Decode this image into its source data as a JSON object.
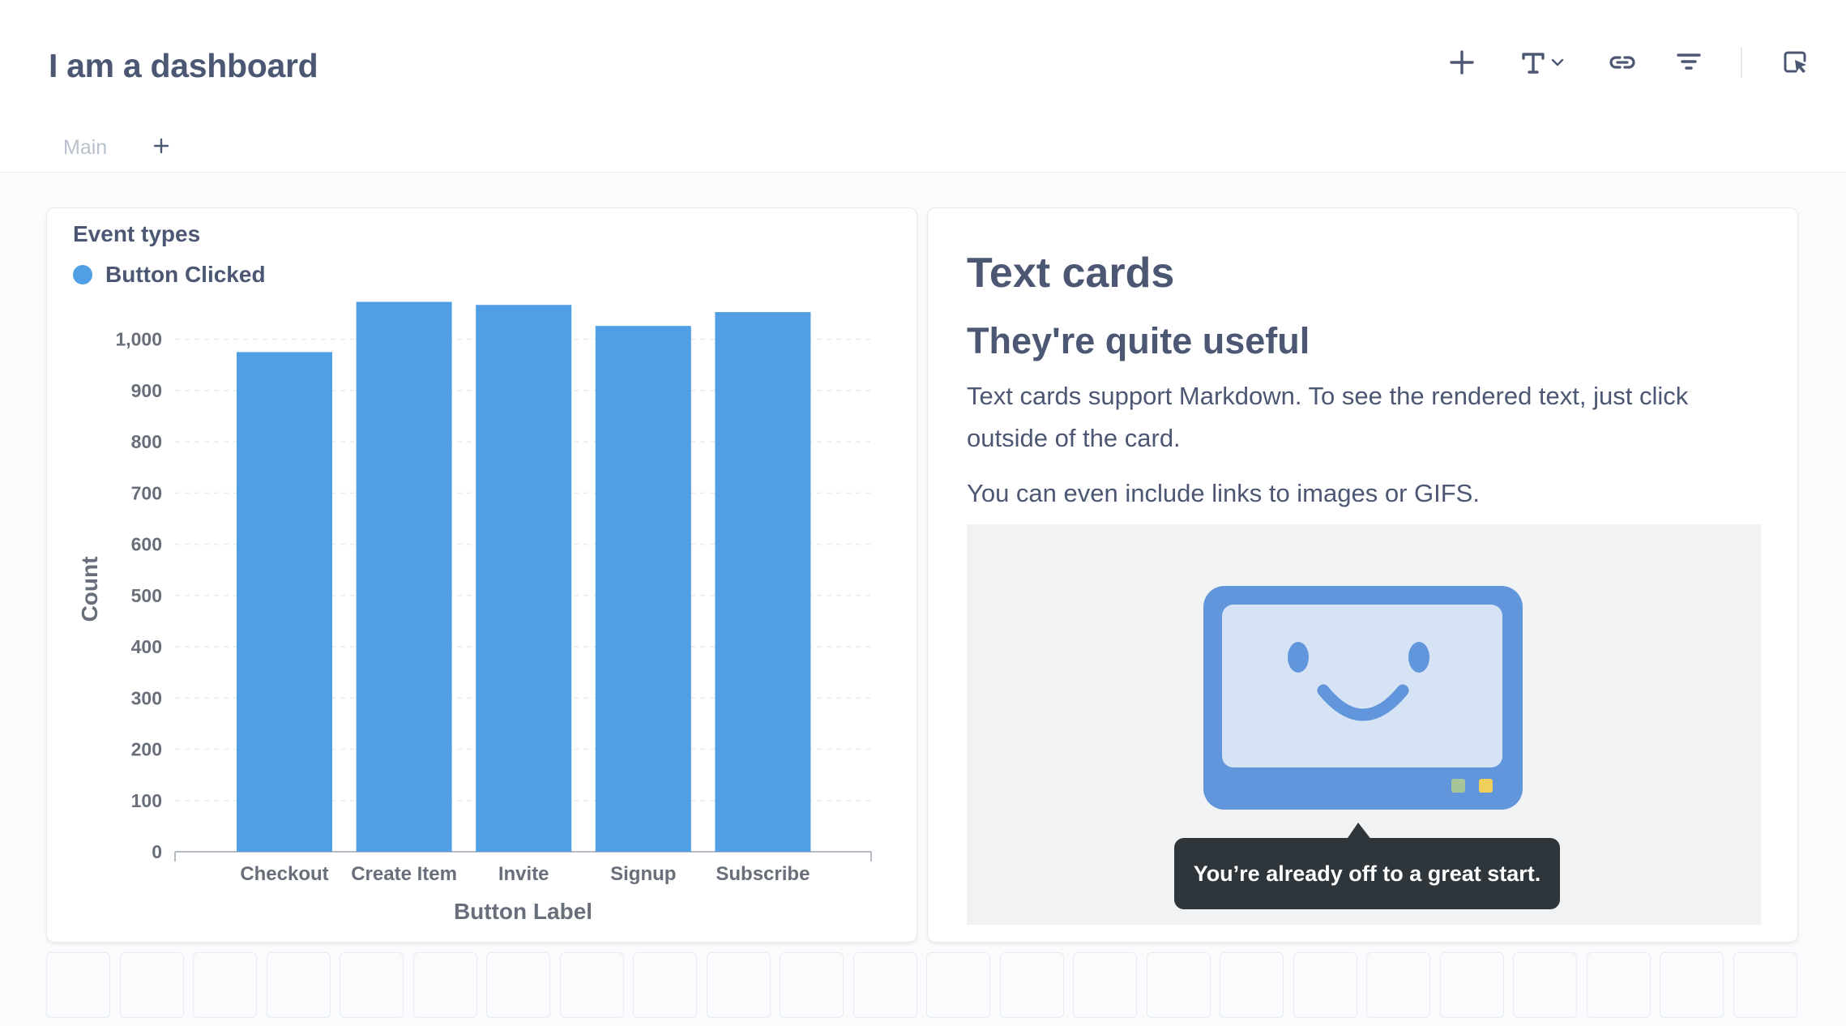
{
  "header": {
    "title": "I am a dashboard",
    "tabs": [
      {
        "label": "Main"
      }
    ],
    "add_tab_label": "+"
  },
  "toolbar": {
    "icons": [
      "add-icon",
      "text-card-icon",
      "chevron-down-icon",
      "link-icon",
      "filter-icon",
      "click-behavior-icon"
    ]
  },
  "chart_card": {
    "title": "Event types",
    "legend": [
      {
        "label": "Button Clicked",
        "color": "#509ee3"
      }
    ]
  },
  "chart_data": {
    "type": "bar",
    "title": "Event types",
    "categories": [
      "Checkout",
      "Create Item",
      "Invite",
      "Signup",
      "Subscribe"
    ],
    "series": [
      {
        "name": "Button Clicked",
        "values": [
          975,
          1073,
          1067,
          1026,
          1053
        ],
        "color": "#509ee3"
      }
    ],
    "xlabel": "Button Label",
    "ylabel": "Count",
    "ylim": [
      0,
      1050
    ],
    "yticks": [
      0,
      100,
      200,
      300,
      400,
      500,
      600,
      700,
      800,
      900,
      1000
    ],
    "ytick_labels": [
      "0",
      "100",
      "200",
      "300",
      "400",
      "500",
      "600",
      "700",
      "800",
      "900",
      "1,000"
    ],
    "grid": true,
    "legend_position": "top-left"
  },
  "text_card": {
    "heading": "Text cards",
    "subheading": "They're quite useful",
    "paragraph_1": "Text cards support Markdown. To see the rendered text, just click outside of the card.",
    "paragraph_2": "You can even include links to images or GIFS.",
    "image": {
      "caption": "You’re already off to a great start."
    }
  },
  "colors": {
    "brand": "#509ee3",
    "text": "#4c5773",
    "muted": "#b8c0cc",
    "tooltip_bg": "#2e353b"
  }
}
